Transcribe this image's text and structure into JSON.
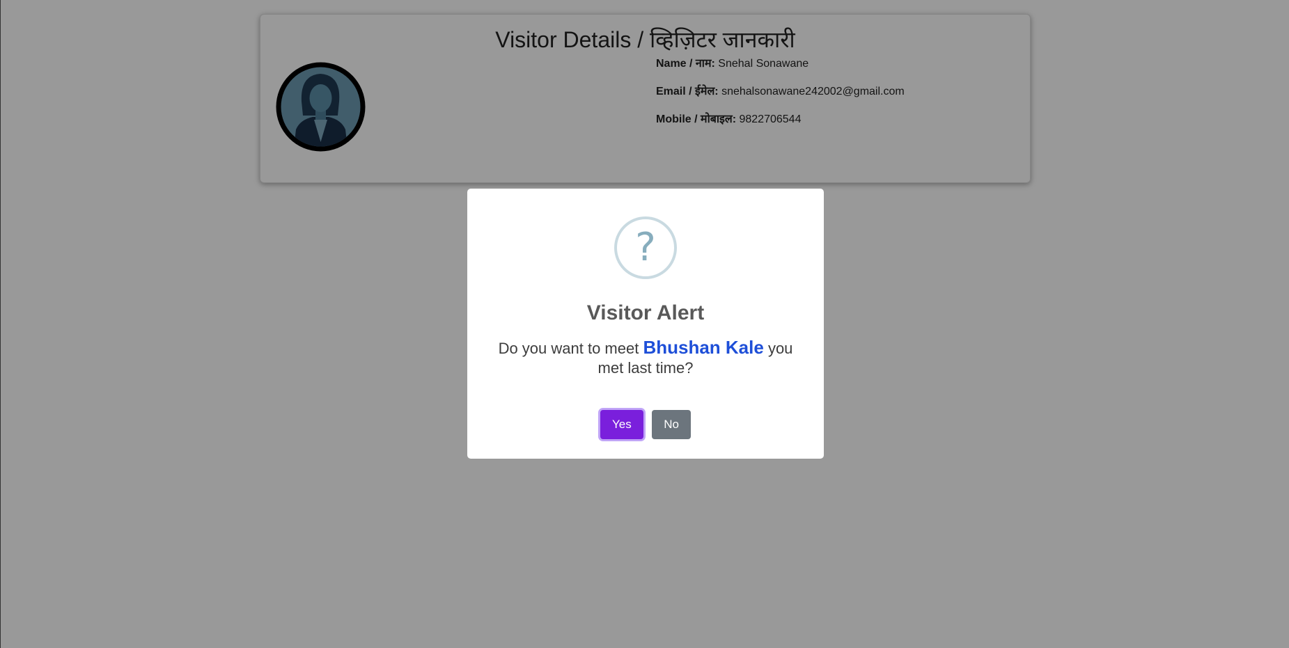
{
  "card": {
    "title": "Visitor Details / व्हिज़िटर जानकारी",
    "name_label": "Name / नाम:",
    "name_value": "Snehal Sonawane",
    "email_label": "Email / ईमेल:",
    "email_value": "snehalsonawane242002@gmail.com",
    "mobile_label": "Mobile / मोबाइल:",
    "mobile_value": "9822706544",
    "avatar_icon": "female-avatar-icon"
  },
  "modal": {
    "icon": "question-icon",
    "icon_glyph": "?",
    "title": "Visitor Alert",
    "text_before": "Do you want to meet ",
    "highlight_name": "Bhushan Kale",
    "text_after": " you met last time?",
    "yes_label": "Yes",
    "no_label": "No"
  },
  "colors": {
    "confirm_button": "#7a1fdc",
    "cancel_button": "#6c757d",
    "highlight_name": "#1e4fd8",
    "question_icon": "#87adbd"
  }
}
